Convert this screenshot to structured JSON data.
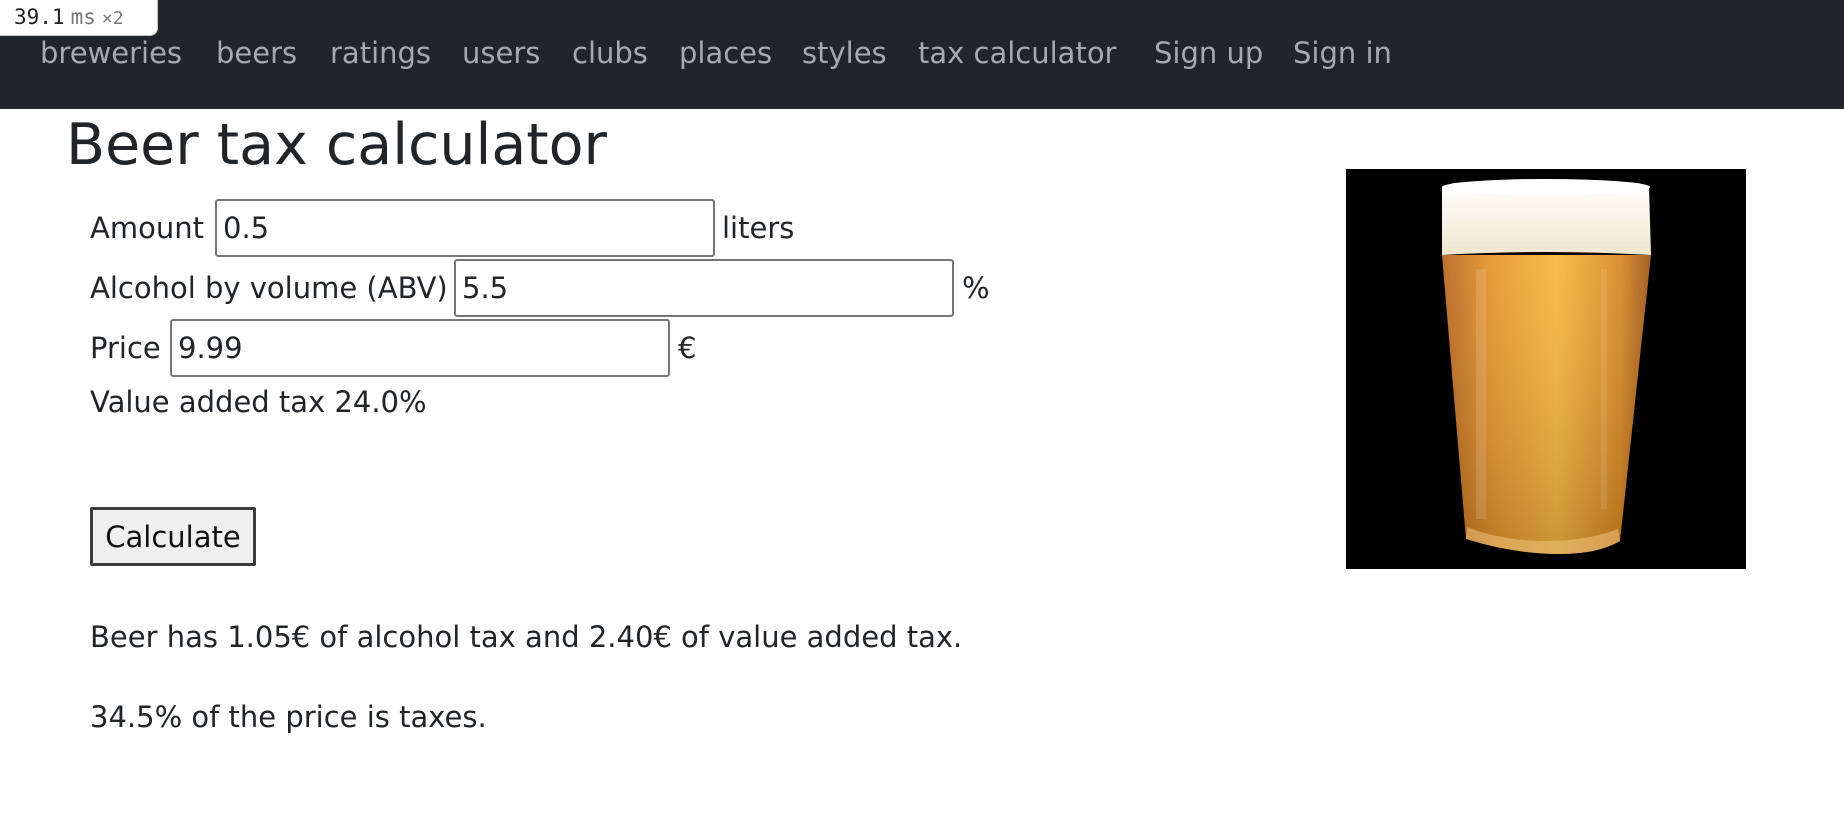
{
  "perf": {
    "value": "39.1",
    "unit": "ms",
    "multiplier": "×2"
  },
  "nav": {
    "items": [
      {
        "label": "breweries"
      },
      {
        "label": "beers"
      },
      {
        "label": "ratings"
      },
      {
        "label": "users"
      },
      {
        "label": "clubs"
      },
      {
        "label": "places"
      },
      {
        "label": "styles"
      },
      {
        "label": "tax calculator"
      },
      {
        "label": "Sign up"
      },
      {
        "label": "Sign in"
      }
    ]
  },
  "page": {
    "title": "Beer tax calculator"
  },
  "form": {
    "amount": {
      "label": "Amount",
      "value": "0.5",
      "unit": "liters"
    },
    "abv": {
      "label": "Alcohol by volume (ABV)",
      "value": "5.5",
      "unit": "%"
    },
    "price": {
      "label": "Price",
      "value": "9.99",
      "unit": "€"
    },
    "vat_text": "Value added tax 24.0%",
    "calculate_label": "Calculate"
  },
  "result": {
    "line1": "Beer has 1.05€ of alcohol tax and 2.40€ of value added tax.",
    "line2": "34.5% of the price is taxes."
  },
  "image": {
    "subject": "glass-of-lager-beer"
  },
  "colors": {
    "navbar_bg": "#212529",
    "nav_text": "#a7a9ac"
  }
}
